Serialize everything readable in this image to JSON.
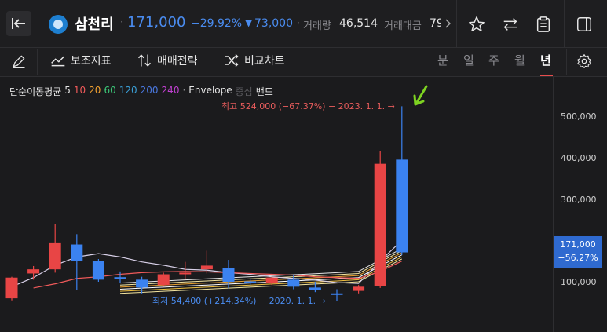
{
  "header": {
    "stock_name": "삼천리",
    "price": "171,000",
    "change_pct": "−29.92%",
    "change_amount": "73,000",
    "volume_label": "거래량",
    "volume_value": "46,514",
    "trade_value_label": "거래대금",
    "trade_value_partial": "79"
  },
  "toolbar": {
    "indicator_label": "보조지표",
    "trade_strategy_label": "매매전략",
    "compare_label": "비교차트",
    "periods": [
      "분",
      "일",
      "주",
      "월",
      "년"
    ],
    "active_period": "년"
  },
  "legend": {
    "ma_label": "단순이동평균",
    "ma_periods": [
      {
        "value": "5",
        "color": "#e6e6e6"
      },
      {
        "value": "10",
        "color": "#f05a5a"
      },
      {
        "value": "20",
        "color": "#f0a030"
      },
      {
        "value": "60",
        "color": "#3cc878"
      },
      {
        "value": "120",
        "color": "#3aa0d8"
      },
      {
        "value": "200",
        "color": "#4a78e0"
      },
      {
        "value": "240",
        "color": "#c040d0"
      }
    ],
    "envelope_label": "Envelope",
    "center_label": "중심",
    "band_label": "밴드"
  },
  "annotations": {
    "high": "최고 524,000 (−67.37%) − 2023. 1. 1. →",
    "low": "최저 54,400 (+214.34%) − 2020. 1. 1. →"
  },
  "y_axis": [
    "500,000",
    "400,000",
    "300,000",
    "100,000"
  ],
  "price_tag": {
    "price": "171,000",
    "pct": "−56.27%"
  },
  "colors": {
    "up": "#e84545",
    "down": "#3b82f0",
    "accent_arrow": "#7ed321"
  },
  "chart_data": {
    "type": "candlestick",
    "title": "삼천리",
    "y_ticks": [
      100000,
      300000,
      400000,
      500000
    ],
    "candles": [
      {
        "dir": "up",
        "open": 60000,
        "close": 110000,
        "high": 112000,
        "low": 55000
      },
      {
        "dir": "up",
        "open": 120000,
        "close": 130000,
        "high": 138000,
        "low": 105000
      },
      {
        "dir": "up",
        "open": 130000,
        "close": 195000,
        "high": 240000,
        "low": 122000
      },
      {
        "dir": "down",
        "open": 190000,
        "close": 150000,
        "high": 215000,
        "low": 80000
      },
      {
        "dir": "down",
        "open": 150000,
        "close": 105000,
        "high": 155000,
        "low": 100000
      },
      {
        "dir": "down",
        "open": 111000,
        "close": 107000,
        "high": 125000,
        "low": 97000
      },
      {
        "dir": "down",
        "open": 105000,
        "close": 86000,
        "high": 112000,
        "low": 72000
      },
      {
        "dir": "up",
        "open": 92000,
        "close": 118000,
        "high": 122000,
        "low": 88000
      },
      {
        "dir": "up",
        "open": 118000,
        "close": 122000,
        "high": 148000,
        "low": 106000
      },
      {
        "dir": "up",
        "open": 130000,
        "close": 139000,
        "high": 175000,
        "low": 120000
      },
      {
        "dir": "down",
        "open": 134000,
        "close": 100000,
        "high": 153000,
        "low": 84000
      },
      {
        "dir": "down",
        "open": 101000,
        "close": 100000,
        "high": 108000,
        "low": 92000
      },
      {
        "dir": "up",
        "open": 96000,
        "close": 110000,
        "high": 112000,
        "low": 92000
      },
      {
        "dir": "down",
        "open": 105000,
        "close": 88000,
        "high": 116000,
        "low": 82000
      },
      {
        "dir": "down",
        "open": 86000,
        "close": 80000,
        "high": 100000,
        "low": 75000
      },
      {
        "dir": "down",
        "open": 72000,
        "close": 72000,
        "high": 82000,
        "low": 54400
      },
      {
        "dir": "up",
        "open": 78000,
        "close": 88000,
        "high": 92000,
        "low": 72000
      },
      {
        "dir": "up",
        "open": 90000,
        "close": 385000,
        "high": 415000,
        "low": 85000
      },
      {
        "dir": "down",
        "open": 395000,
        "close": 171000,
        "high": 524000,
        "low": 165000
      }
    ]
  }
}
